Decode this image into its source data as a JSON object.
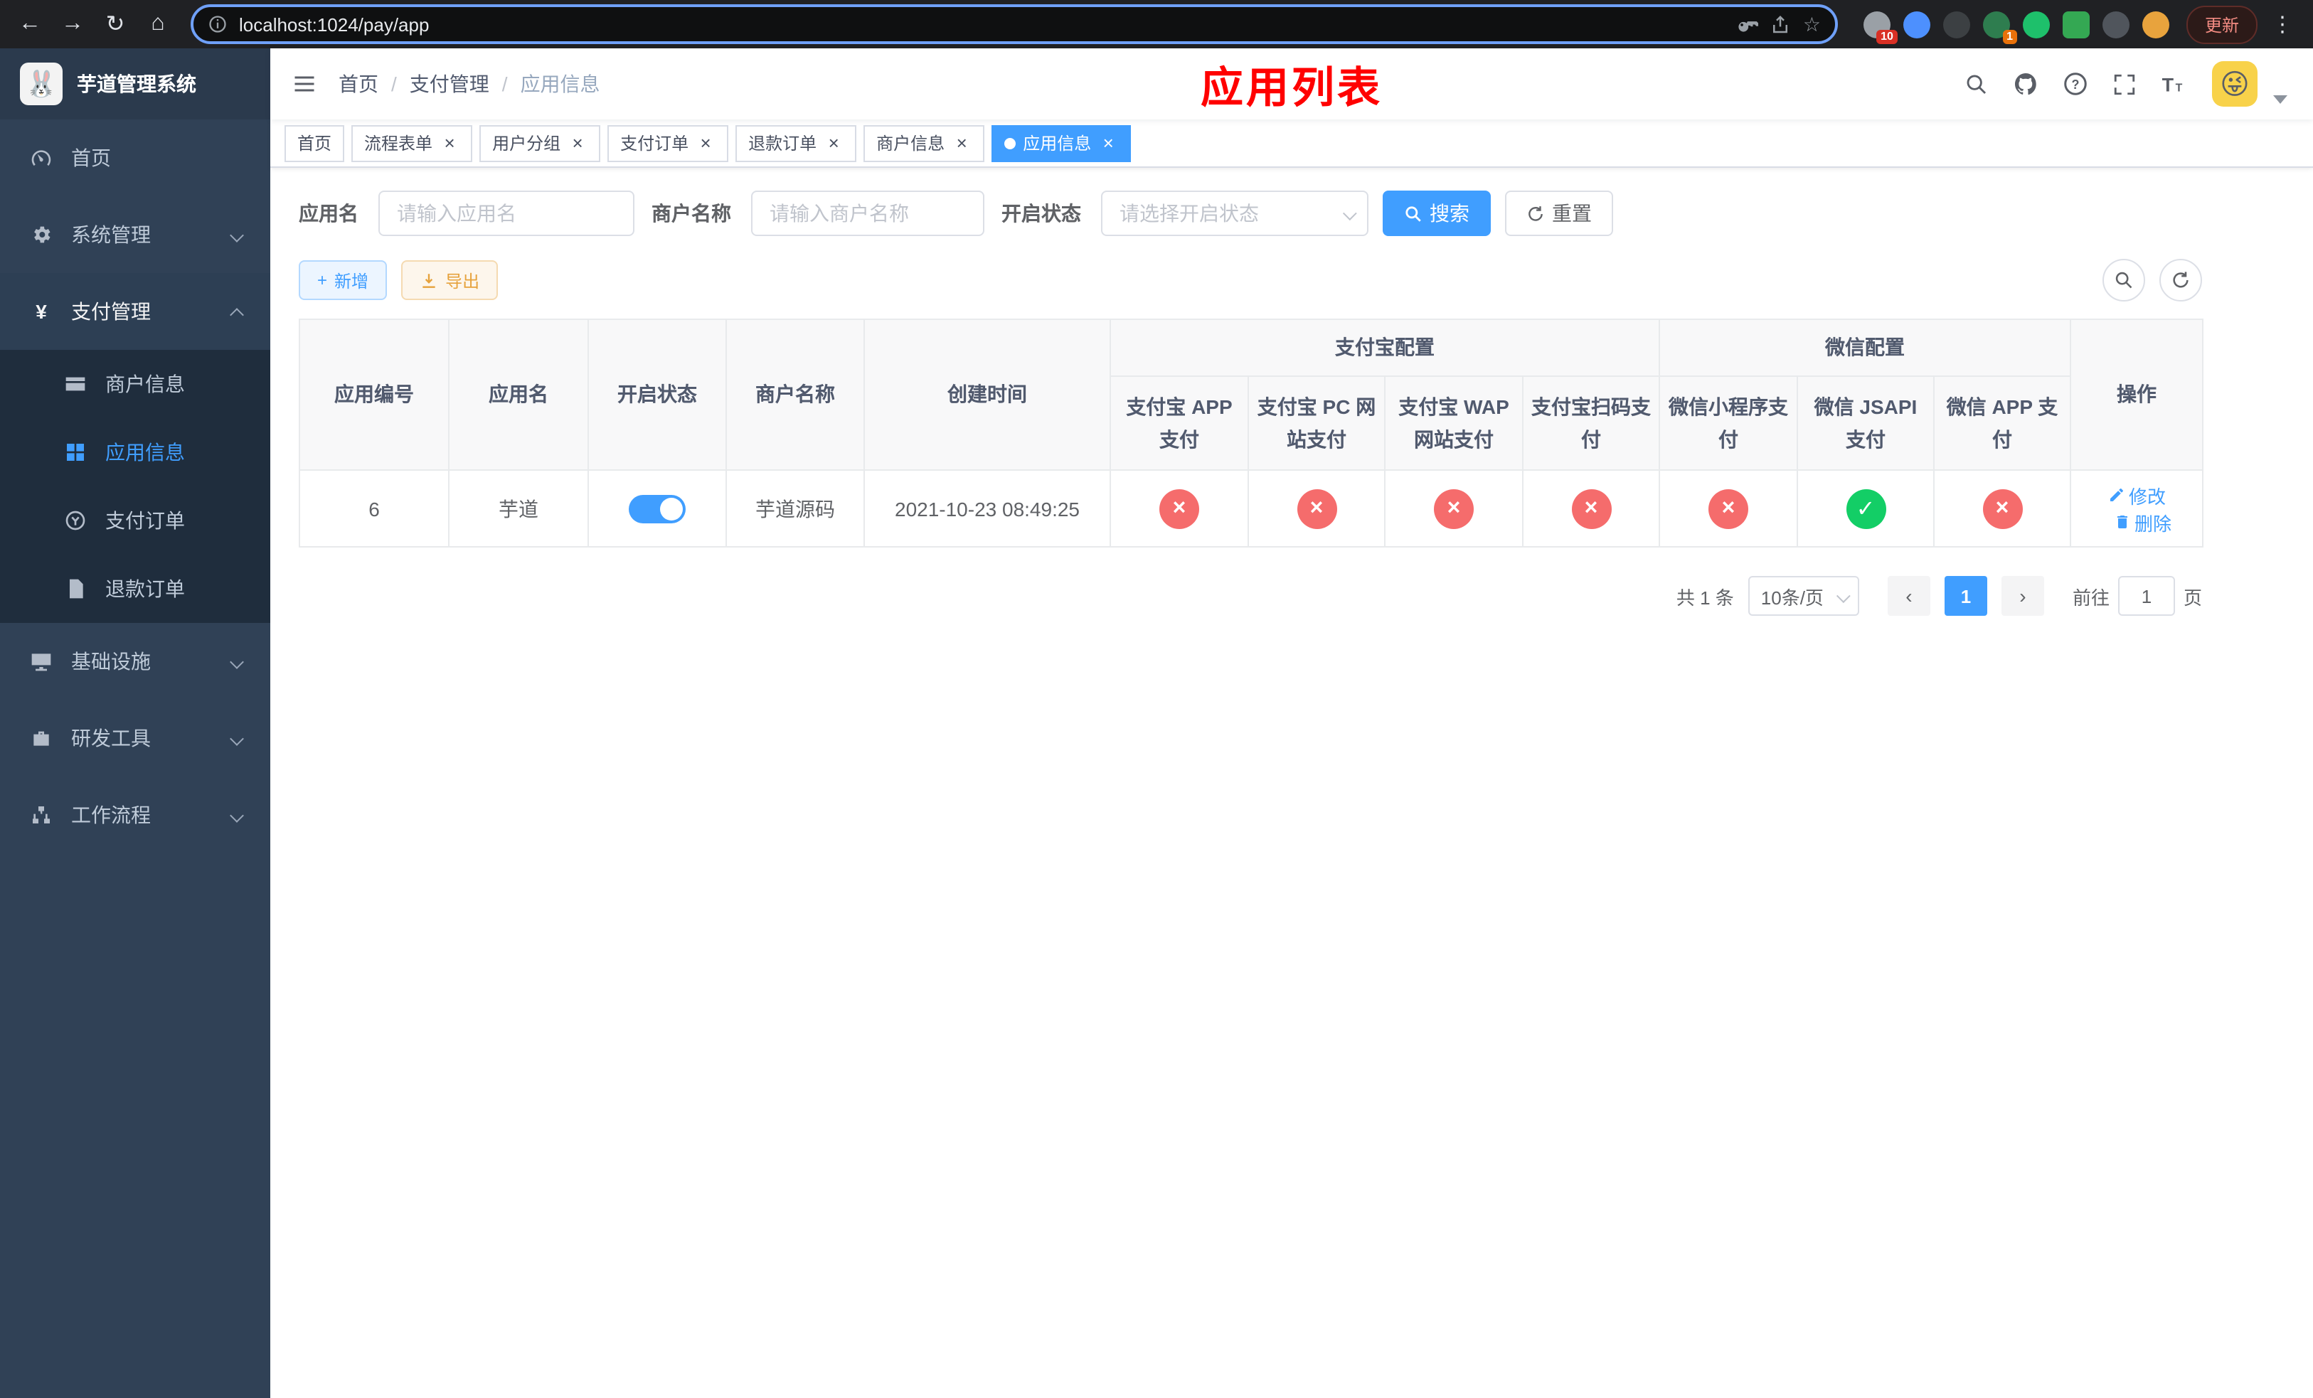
{
  "browser": {
    "url": "localhost:1024/pay/app",
    "update_label": "更新",
    "extensions_badge": "10",
    "profile_badge": "1"
  },
  "icons": {
    "back": "←",
    "forward": "→",
    "reload": "↻",
    "home": "⌂",
    "star": "☆",
    "menu_dots": "⋮",
    "prev": "‹",
    "next": "›",
    "plus": "+",
    "close": "×",
    "check": "✓",
    "cross": "×",
    "yen": "¥",
    "emoji_logo": "🐰",
    "emoji_avatar": "😜"
  },
  "sidebar": {
    "logo_title": "芋道管理系统",
    "items": [
      {
        "label": "首页"
      },
      {
        "label": "系统管理"
      },
      {
        "label": "支付管理"
      },
      {
        "label": "基础设施"
      },
      {
        "label": "研发工具"
      },
      {
        "label": "工作流程"
      }
    ],
    "pay_children": [
      {
        "label": "商户信息"
      },
      {
        "label": "应用信息"
      },
      {
        "label": "支付订单"
      },
      {
        "label": "退款订单"
      }
    ]
  },
  "header": {
    "breadcrumb": [
      {
        "label": "首页"
      },
      {
        "label": "支付管理"
      },
      {
        "label": "应用信息"
      }
    ],
    "page_title": "应用列表",
    "title_color": "#ff0000"
  },
  "tabs": [
    {
      "label": "首页"
    },
    {
      "label": "流程表单"
    },
    {
      "label": "用户分组"
    },
    {
      "label": "支付订单"
    },
    {
      "label": "退款订单"
    },
    {
      "label": "商户信息"
    },
    {
      "label": "应用信息"
    }
  ],
  "filters": {
    "app_name_label": "应用名",
    "app_name_placeholder": "请输入应用名",
    "merchant_label": "商户名称",
    "merchant_placeholder": "请输入商户名称",
    "status_label": "开启状态",
    "status_placeholder": "请选择开启状态",
    "search_label": "搜索",
    "reset_label": "重置"
  },
  "toolbar": {
    "add_label": "新增",
    "export_label": "导出"
  },
  "table": {
    "groups": {
      "alipay": "支付宝配置",
      "wechat": "微信配置"
    },
    "columns": [
      "应用编号",
      "应用名",
      "开启状态",
      "商户名称",
      "创建时间",
      "支付宝 APP 支付",
      "支付宝 PC 网站支付",
      "支付宝 WAP 网站支付",
      "支付宝扫码支付",
      "微信小程序支付",
      "微信 JSAPI 支付",
      "微信 APP 支付",
      "操作"
    ],
    "rows": [
      {
        "id": "6",
        "name": "芋道",
        "enabled": true,
        "merchant": "芋道源码",
        "created_at": "2021-10-23 08:49:25",
        "alipay_app": false,
        "alipay_pc": false,
        "alipay_wap": false,
        "alipay_qr": false,
        "wechat_mini": false,
        "wechat_jsapi": true,
        "wechat_app": false,
        "edit_label": "修改",
        "delete_label": "删除"
      }
    ]
  },
  "pagination": {
    "total_text": "共 1 条",
    "page_size_text": "10条/页",
    "current_page": "1",
    "goto_label": "前往",
    "goto_value": "1",
    "goto_suffix": "页"
  },
  "colors": {
    "accent": "#409eff",
    "success": "#13ce66",
    "danger": "#f56c6c",
    "warning": "#e6a23c",
    "sidebar_bg": "#304156",
    "submenu_bg": "#1f2d3d"
  }
}
